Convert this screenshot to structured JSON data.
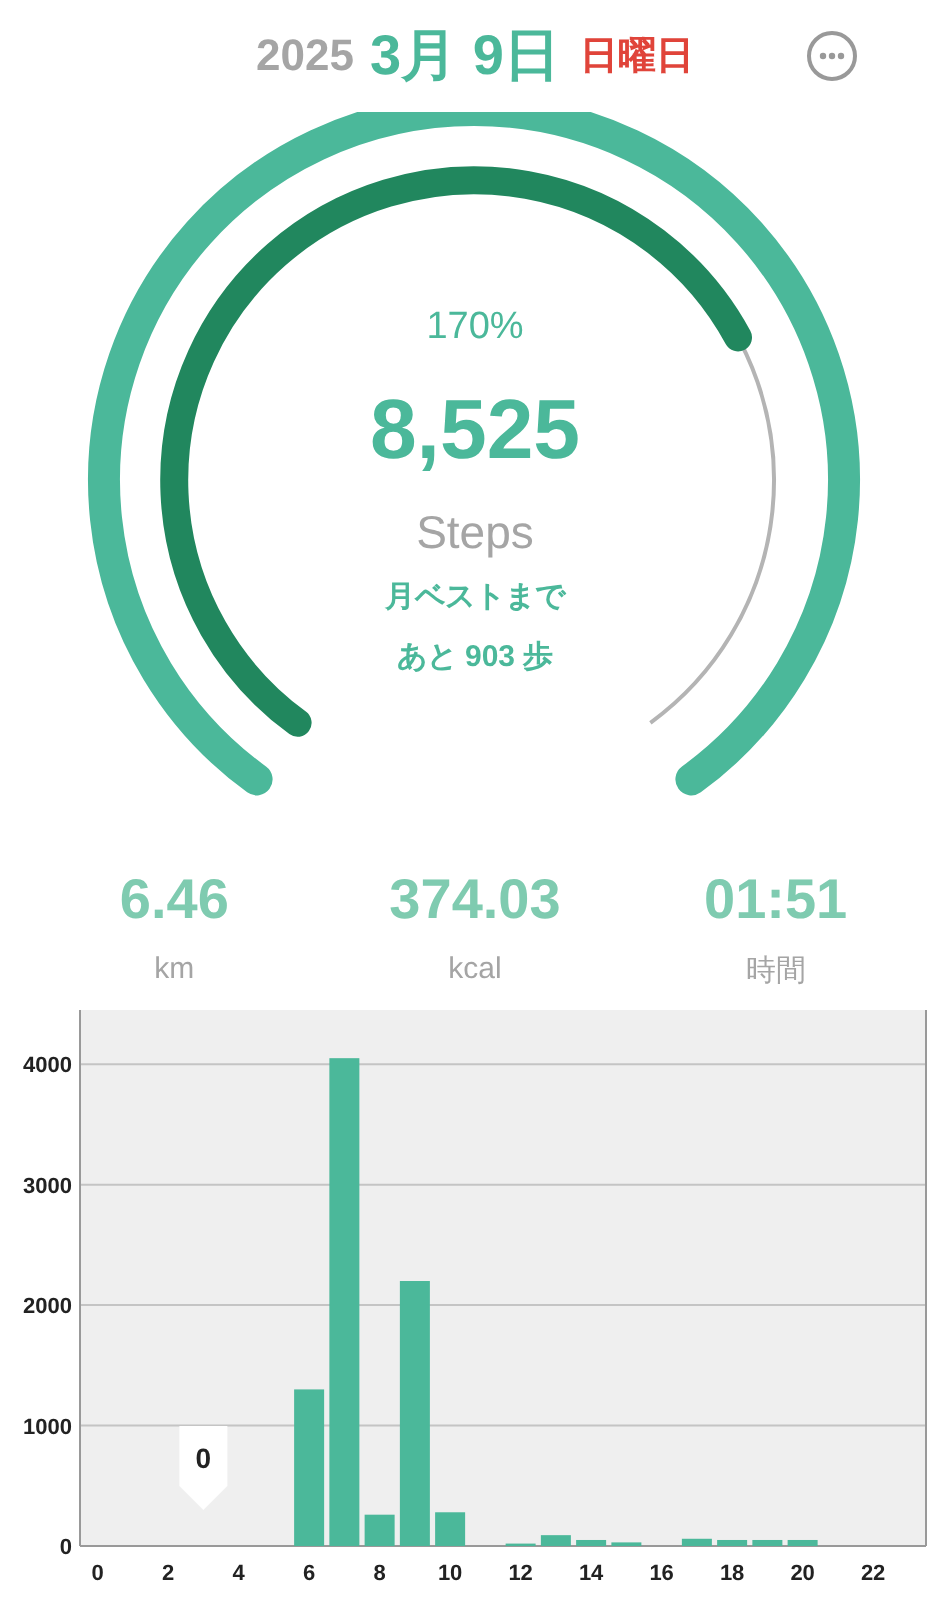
{
  "header": {
    "year": "2025",
    "date": "3月 9日",
    "weekday": "日曜日"
  },
  "gauge": {
    "percent": "170%",
    "steps": "8,525",
    "unit": "Steps",
    "note_lines": [
      "月ベストまで",
      "あと 903 歩"
    ]
  },
  "stats": [
    {
      "value": "6.46",
      "unit": "km"
    },
    {
      "value": "374.03",
      "unit": "kcal"
    },
    {
      "value": "01:51",
      "unit": "時間"
    }
  ],
  "chart": {
    "chart_data": {
      "type": "bar",
      "grid": true,
      "x": [
        0,
        1,
        2,
        3,
        4,
        5,
        6,
        7,
        8,
        9,
        10,
        11,
        12,
        13,
        14,
        15,
        16,
        17,
        18,
        19,
        20,
        21,
        22,
        23
      ],
      "series": [
        {
          "color": "#4bb89a",
          "values": [
            0,
            0,
            0,
            0,
            0,
            0,
            1300,
            4050,
            260,
            2200,
            280,
            0,
            20,
            90,
            50,
            30,
            0,
            60,
            50,
            50,
            50,
            0,
            0,
            0
          ]
        }
      ],
      "xlim": [
        -0.5,
        23.5
      ],
      "ylim": [
        0,
        4450
      ],
      "xticks": [
        0,
        2,
        4,
        6,
        8,
        10,
        12,
        14,
        16,
        18,
        20,
        22
      ],
      "yticks": [
        0,
        1000,
        2000,
        3000,
        4000
      ],
      "annotations": [
        {
          "x": 3,
          "y": 0,
          "text": "0"
        }
      ]
    }
  }
}
